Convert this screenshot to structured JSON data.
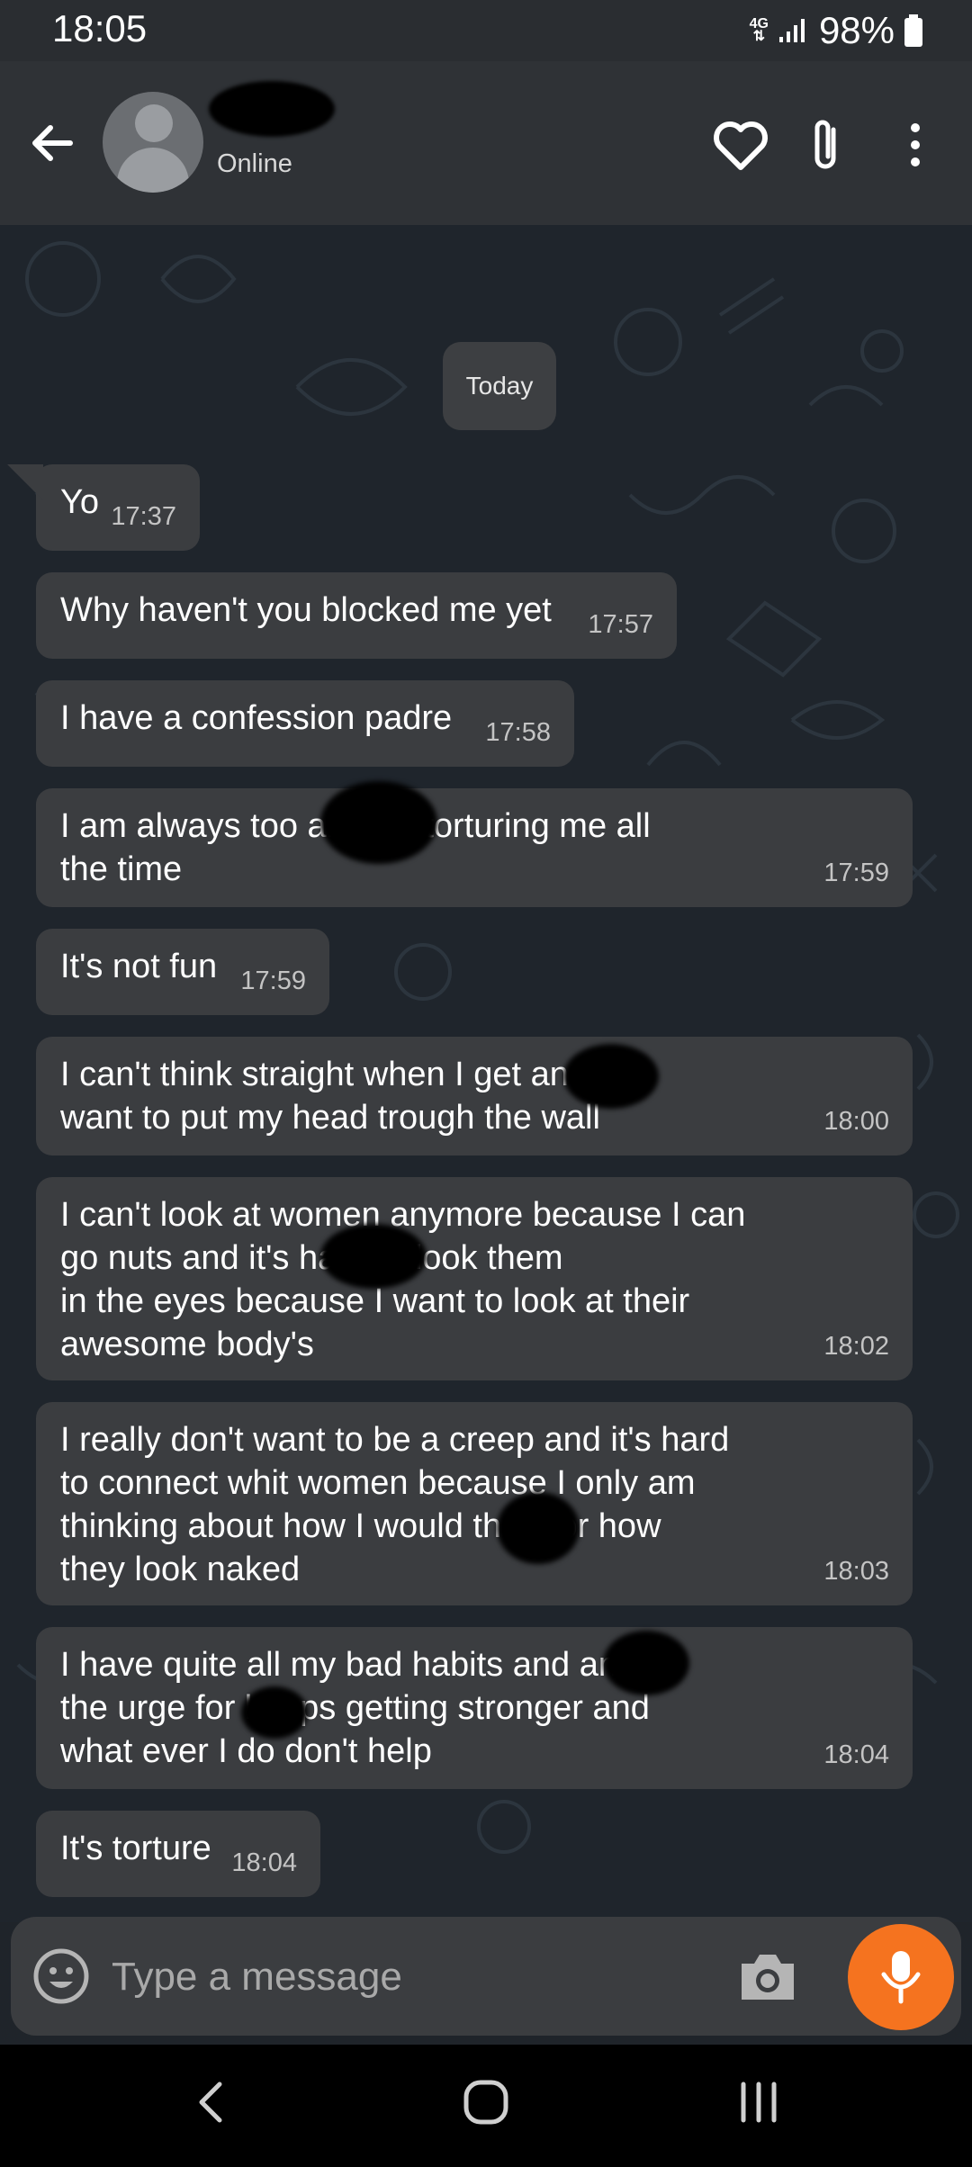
{
  "status_bar": {
    "time": "18:05",
    "network": "4G",
    "battery": "98%"
  },
  "header": {
    "contact_status": "Online"
  },
  "date_divider": "Today",
  "messages": [
    {
      "text": "Yo",
      "time": "17:37"
    },
    {
      "text": "Why haven't you blocked me yet",
      "time": "17:57"
    },
    {
      "text": "I have a confession padre",
      "time": "17:58"
    },
    {
      "text": "I am always too         and it's torturing me all\nthe time",
      "time": "17:59"
    },
    {
      "text": "It's not fun",
      "time": "17:59"
    },
    {
      "text": "I can't think straight when I get         and i\nwant to put my head trough the wall",
      "time": "18:00"
    },
    {
      "text": "I can't look at women anymore because I can\ngo nuts and it's         hard to look them\nin the eyes because I want to look at their\nawesome body's",
      "time": "18:02"
    },
    {
      "text": "I really don't want to be a creep and it's hard\nto connect whit women because I only am\nthinking about how I would         them or how\nthey look naked",
      "time": "18:03"
    },
    {
      "text": "I have quite all my bad habits and         and\nthe urge for         keeps getting stronger and\nwhat ever I do don't help",
      "time": "18:04"
    },
    {
      "text": "It's torture",
      "time": "18:04"
    }
  ],
  "input": {
    "placeholder": "Type a message"
  },
  "colors": {
    "accent": "#f5731f",
    "bubble": "#3b3d40",
    "header": "#2f3236"
  },
  "icons": [
    "back-arrow-icon",
    "heart-icon",
    "paperclip-icon",
    "more-vert-icon",
    "emoji-icon",
    "camera-icon",
    "mic-icon",
    "nav-back-icon",
    "nav-home-icon",
    "nav-recents-icon"
  ]
}
